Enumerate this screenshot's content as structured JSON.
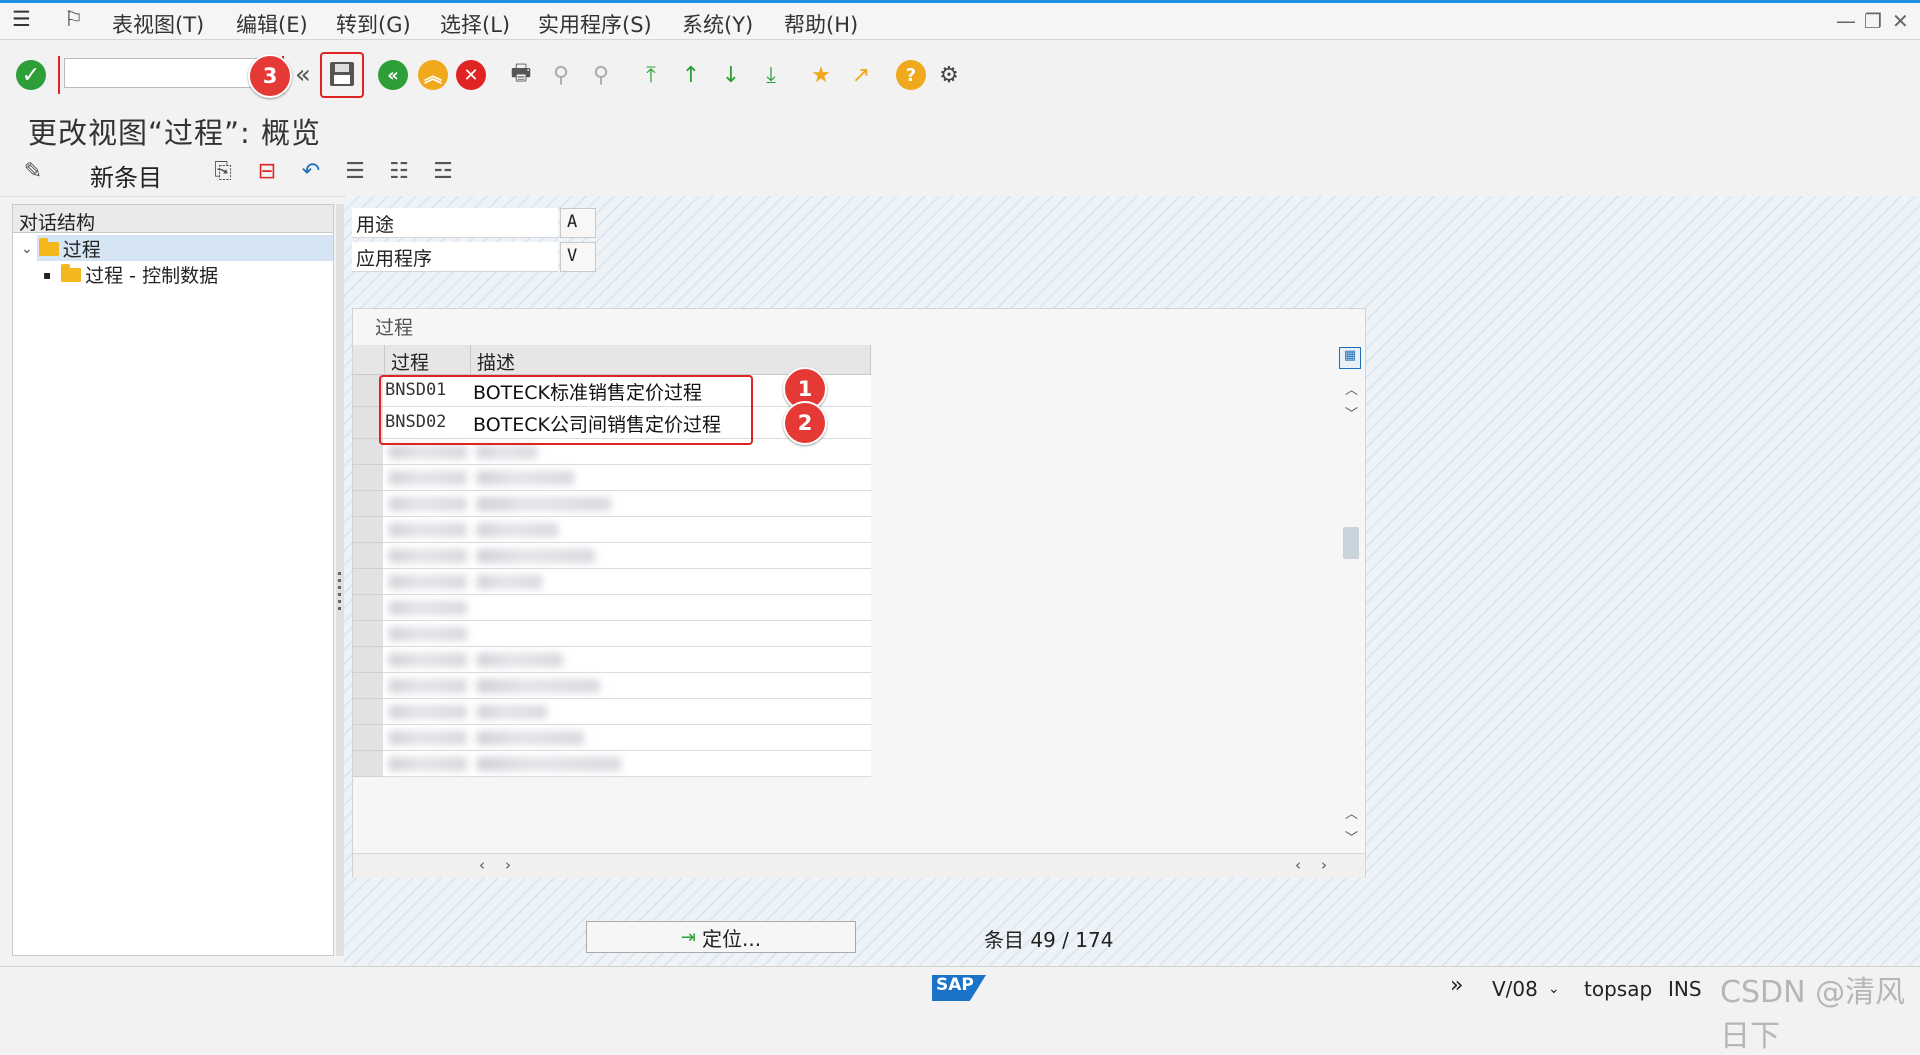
{
  "menu": {
    "items": [
      "表视图(T)",
      "编辑(E)",
      "转到(G)",
      "选择(L)",
      "实用程序(S)",
      "系统(Y)",
      "帮助(H)"
    ]
  },
  "toolbar": {
    "command_field_value": "",
    "icons": [
      "check-icon",
      "back-chevron-icon",
      "save-icon",
      "back-icon",
      "exit-icon",
      "cancel-icon",
      "print-icon",
      "find-icon",
      "find-next-icon",
      "first-page-icon",
      "previous-page-icon",
      "next-page-icon",
      "last-page-icon",
      "new-session-icon",
      "shortcut-icon",
      "help-icon",
      "settings-icon"
    ]
  },
  "page": {
    "title": "更改视图“过程”: 概览"
  },
  "app_toolbar": {
    "new_entries": "新条目"
  },
  "tree": {
    "header": "对话结构",
    "nodes": [
      {
        "label": "过程"
      },
      {
        "label": "过程 - 控制数据"
      }
    ]
  },
  "fields": [
    {
      "label": "用途",
      "value": "A"
    },
    {
      "label": "应用程序",
      "value": "V"
    }
  ],
  "table": {
    "caption": "过程",
    "columns": [
      "过程",
      "描述"
    ],
    "rows": [
      {
        "code": "BNSD01",
        "desc": "BOTECK标准销售定价过程"
      },
      {
        "code": "BNSD02",
        "desc": "BOTECK公司间销售定价过程"
      }
    ],
    "blurred_row_count": 13
  },
  "annotations": [
    "1",
    "2",
    "3"
  ],
  "footer": {
    "locate_label": "定位...",
    "entry_label": "条目",
    "entry_value": "49 / 174"
  },
  "status": {
    "sap_logo": "SAP",
    "system": "V/08",
    "server": "topsap",
    "mode": "INS",
    "watermark": "CSDN @清风日下"
  },
  "colors": {
    "accent": "#1f8de0",
    "annotation_red": "#e53935",
    "ok_green": "#2e9e38",
    "save_red": "#e02424"
  }
}
